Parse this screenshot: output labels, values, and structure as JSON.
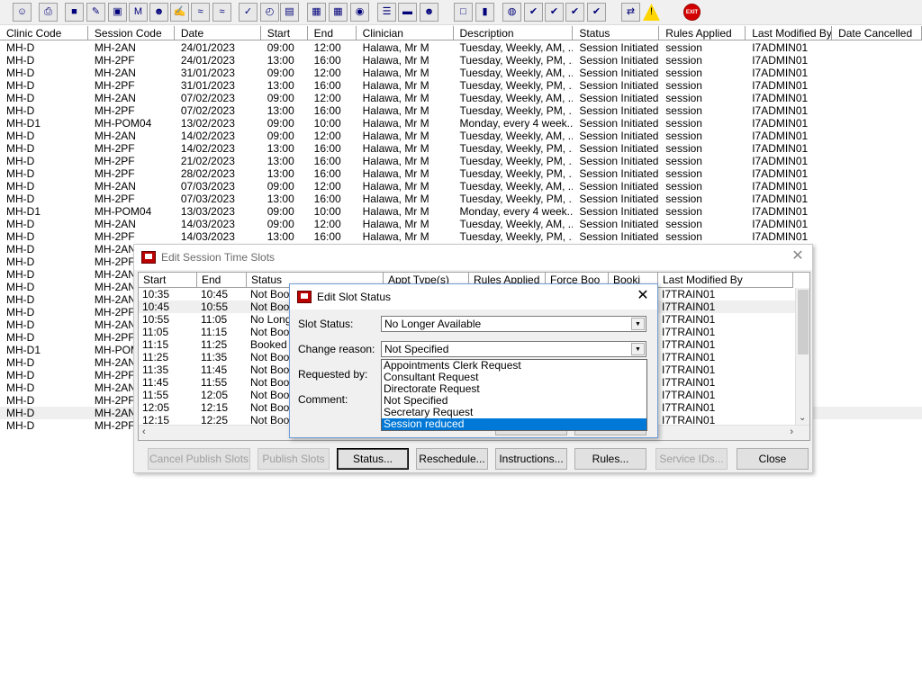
{
  "toolbar": {
    "icons": [
      "user-icon",
      "print-icon",
      "book-icon",
      "edit-icon",
      "tree-icon",
      "m-icon",
      "person-icon",
      "note-icon",
      "wave-icon",
      "wave2-icon",
      "tick-icon",
      "clock-icon",
      "list-icon",
      "image-icon",
      "image2-icon",
      "cd-icon",
      "doc-icon",
      "car-icon",
      "user2-icon",
      "page-icon",
      "bars-icon",
      "globe-icon",
      "check-icon",
      "check2-icon",
      "tick2-icon",
      "tick3-icon",
      "swap-icon",
      "warning-icon",
      "exit-icon"
    ],
    "exit_label": "EXIT"
  },
  "main_grid": {
    "columns": [
      "Clinic Code",
      "Session Code",
      "Date",
      "Start",
      "End",
      "Clinician",
      "Description",
      "Status",
      "Rules Applied",
      "Last Modified By",
      "Date Cancelled"
    ],
    "rows": [
      [
        "MH-D",
        "MH-2AN",
        "24/01/2023",
        "09:00",
        "12:00",
        "Halawa, Mr M",
        "Tuesday, Weekly, AM, ...",
        "Session Initiated",
        "session",
        "I7ADMIN01",
        ""
      ],
      [
        "MH-D",
        "MH-2PF",
        "24/01/2023",
        "13:00",
        "16:00",
        "Halawa, Mr M",
        "Tuesday, Weekly, PM, ...",
        "Session Initiated",
        "session",
        "I7ADMIN01",
        ""
      ],
      [
        "MH-D",
        "MH-2AN",
        "31/01/2023",
        "09:00",
        "12:00",
        "Halawa, Mr M",
        "Tuesday, Weekly, AM, ...",
        "Session Initiated",
        "session",
        "I7ADMIN01",
        ""
      ],
      [
        "MH-D",
        "MH-2PF",
        "31/01/2023",
        "13:00",
        "16:00",
        "Halawa, Mr M",
        "Tuesday, Weekly, PM, ...",
        "Session Initiated",
        "session",
        "I7ADMIN01",
        ""
      ],
      [
        "MH-D",
        "MH-2AN",
        "07/02/2023",
        "09:00",
        "12:00",
        "Halawa, Mr M",
        "Tuesday, Weekly, AM, ...",
        "Session Initiated",
        "session",
        "I7ADMIN01",
        ""
      ],
      [
        "MH-D",
        "MH-2PF",
        "07/02/2023",
        "13:00",
        "16:00",
        "Halawa, Mr M",
        "Tuesday, Weekly, PM, ...",
        "Session Initiated",
        "session",
        "I7ADMIN01",
        ""
      ],
      [
        "MH-D1",
        "MH-POM04",
        "13/02/2023",
        "09:00",
        "10:00",
        "Halawa, Mr M",
        "Monday, every 4 week...",
        "Session Initiated",
        "session",
        "I7ADMIN01",
        ""
      ],
      [
        "MH-D",
        "MH-2AN",
        "14/02/2023",
        "09:00",
        "12:00",
        "Halawa, Mr M",
        "Tuesday, Weekly, AM, ...",
        "Session Initiated",
        "session",
        "I7ADMIN01",
        ""
      ],
      [
        "MH-D",
        "MH-2PF",
        "14/02/2023",
        "13:00",
        "16:00",
        "Halawa, Mr M",
        "Tuesday, Weekly, PM, ...",
        "Session Initiated",
        "session",
        "I7ADMIN01",
        ""
      ],
      [
        "MH-D",
        "MH-2PF",
        "21/02/2023",
        "13:00",
        "16:00",
        "Halawa, Mr M",
        "Tuesday, Weekly, PM, ...",
        "Session Initiated",
        "session",
        "I7ADMIN01",
        ""
      ],
      [
        "MH-D",
        "MH-2PF",
        "28/02/2023",
        "13:00",
        "16:00",
        "Halawa, Mr M",
        "Tuesday, Weekly, PM, ...",
        "Session Initiated",
        "session",
        "I7ADMIN01",
        ""
      ],
      [
        "MH-D",
        "MH-2AN",
        "07/03/2023",
        "09:00",
        "12:00",
        "Halawa, Mr M",
        "Tuesday, Weekly, AM, ...",
        "Session Initiated",
        "session",
        "I7ADMIN01",
        ""
      ],
      [
        "MH-D",
        "MH-2PF",
        "07/03/2023",
        "13:00",
        "16:00",
        "Halawa, Mr M",
        "Tuesday, Weekly, PM, ...",
        "Session Initiated",
        "session",
        "I7ADMIN01",
        ""
      ],
      [
        "MH-D1",
        "MH-POM04",
        "13/03/2023",
        "09:00",
        "10:00",
        "Halawa, Mr M",
        "Monday, every 4 week...",
        "Session Initiated",
        "session",
        "I7ADMIN01",
        ""
      ],
      [
        "MH-D",
        "MH-2AN",
        "14/03/2023",
        "09:00",
        "12:00",
        "Halawa, Mr M",
        "Tuesday, Weekly, AM, ...",
        "Session Initiated",
        "session",
        "I7ADMIN01",
        ""
      ],
      [
        "MH-D",
        "MH-2PF",
        "14/03/2023",
        "13:00",
        "16:00",
        "Halawa, Mr M",
        "Tuesday, Weekly, PM, ...",
        "Session Initiated",
        "session",
        "I7ADMIN01",
        ""
      ],
      [
        "MH-D",
        "MH-2AN",
        "",
        "",
        "",
        "",
        "",
        "",
        "",
        "",
        ""
      ],
      [
        "MH-D",
        "MH-2PF",
        "",
        "",
        "",
        "",
        "",
        "",
        "",
        "",
        ""
      ],
      [
        "MH-D",
        "MH-2AN",
        "",
        "",
        "",
        "",
        "",
        "",
        "",
        "",
        ""
      ],
      [
        "MH-D",
        "MH-2AN",
        "",
        "",
        "",
        "",
        "",
        "",
        "",
        "",
        ""
      ],
      [
        "MH-D",
        "MH-2AN",
        "",
        "",
        "",
        "",
        "",
        "",
        "",
        "",
        ""
      ],
      [
        "MH-D",
        "MH-2PF",
        "",
        "",
        "",
        "",
        "",
        "",
        "",
        "",
        ""
      ],
      [
        "MH-D",
        "MH-2AN",
        "",
        "",
        "",
        "",
        "",
        "",
        "",
        "",
        ""
      ],
      [
        "MH-D",
        "MH-2PF",
        "",
        "",
        "",
        "",
        "",
        "",
        "",
        "",
        ""
      ],
      [
        "MH-D1",
        "MH-POM",
        "",
        "",
        "",
        "",
        "",
        "",
        "",
        "",
        ""
      ],
      [
        "MH-D",
        "MH-2AN",
        "",
        "",
        "",
        "",
        "",
        "",
        "",
        "",
        ""
      ],
      [
        "MH-D",
        "MH-2PF",
        "",
        "",
        "",
        "",
        "",
        "",
        "",
        "",
        ""
      ],
      [
        "MH-D",
        "MH-2AN",
        "",
        "",
        "",
        "",
        "",
        "",
        "",
        "",
        ""
      ],
      [
        "MH-D",
        "MH-2PF",
        "",
        "",
        "",
        "",
        "",
        "",
        "",
        "",
        ""
      ],
      [
        "MH-D",
        "MH-2AN",
        "",
        "",
        "",
        "",
        "",
        "",
        "",
        "",
        ""
      ],
      [
        "MH-D",
        "MH-2PF",
        "",
        "",
        "",
        "",
        "",
        "",
        "",
        "",
        ""
      ]
    ]
  },
  "slots_window": {
    "title": "Edit Session Time Slots",
    "columns": [
      "Start",
      "End",
      "Status",
      "Appt Type(s)",
      "Rules Applied",
      "Force Boo",
      "Booki",
      "Last Modified By"
    ],
    "rows": [
      [
        "10:35",
        "10:45",
        "Not Book",
        "",
        "",
        "",
        "",
        "I7TRAIN01"
      ],
      [
        "10:45",
        "10:55",
        "Not Book",
        "",
        "",
        "",
        "",
        "I7TRAIN01"
      ],
      [
        "10:55",
        "11:05",
        "No Longe",
        "",
        "",
        "",
        "",
        "I7TRAIN01"
      ],
      [
        "11:05",
        "11:15",
        "Not Book",
        "",
        "",
        "",
        "",
        "I7TRAIN01"
      ],
      [
        "11:15",
        "11:25",
        "Booked",
        "",
        "",
        "",
        "",
        "I7TRAIN01"
      ],
      [
        "11:25",
        "11:35",
        "Not Book",
        "",
        "",
        "",
        "",
        "I7TRAIN01"
      ],
      [
        "11:35",
        "11:45",
        "Not Book",
        "",
        "",
        "",
        "",
        "I7TRAIN01"
      ],
      [
        "11:45",
        "11:55",
        "Not Book",
        "",
        "",
        "",
        "",
        "I7TRAIN01"
      ],
      [
        "11:55",
        "12:05",
        "Not Book",
        "",
        "",
        "",
        "",
        "I7TRAIN01"
      ],
      [
        "12:05",
        "12:15",
        "Not Book",
        "",
        "",
        "",
        "",
        "I7TRAIN01"
      ],
      [
        "12:15",
        "12:25",
        "Not Book",
        "",
        "",
        "",
        "",
        "I7TRAIN01"
      ]
    ],
    "buttons": {
      "cancel_publish": "Cancel Publish Slots",
      "publish": "Publish Slots",
      "status": "Status...",
      "reschedule": "Reschedule...",
      "instructions": "Instructions...",
      "rules": "Rules...",
      "service_ids": "Service IDs...",
      "close": "Close"
    }
  },
  "status_dialog": {
    "title": "Edit Slot Status",
    "slot_status_label": "Slot Status:",
    "slot_status_value": "No Longer Available",
    "change_reason_label": "Change reason:",
    "change_reason_value": "Not Specified",
    "requested_by_label": "Requested by:",
    "comment_label": "Comment:",
    "reason_options": [
      "Appointments Clerk Request",
      "Consultant Request",
      "Directorate Request",
      "Not Specified",
      "Secretary Request",
      "Session reduced"
    ],
    "selected_option": "Session reduced"
  },
  "colors": {
    "selection": "#0078d7",
    "dialog_border": "#6f9ed6",
    "window_bg": "#f0f0f0"
  }
}
